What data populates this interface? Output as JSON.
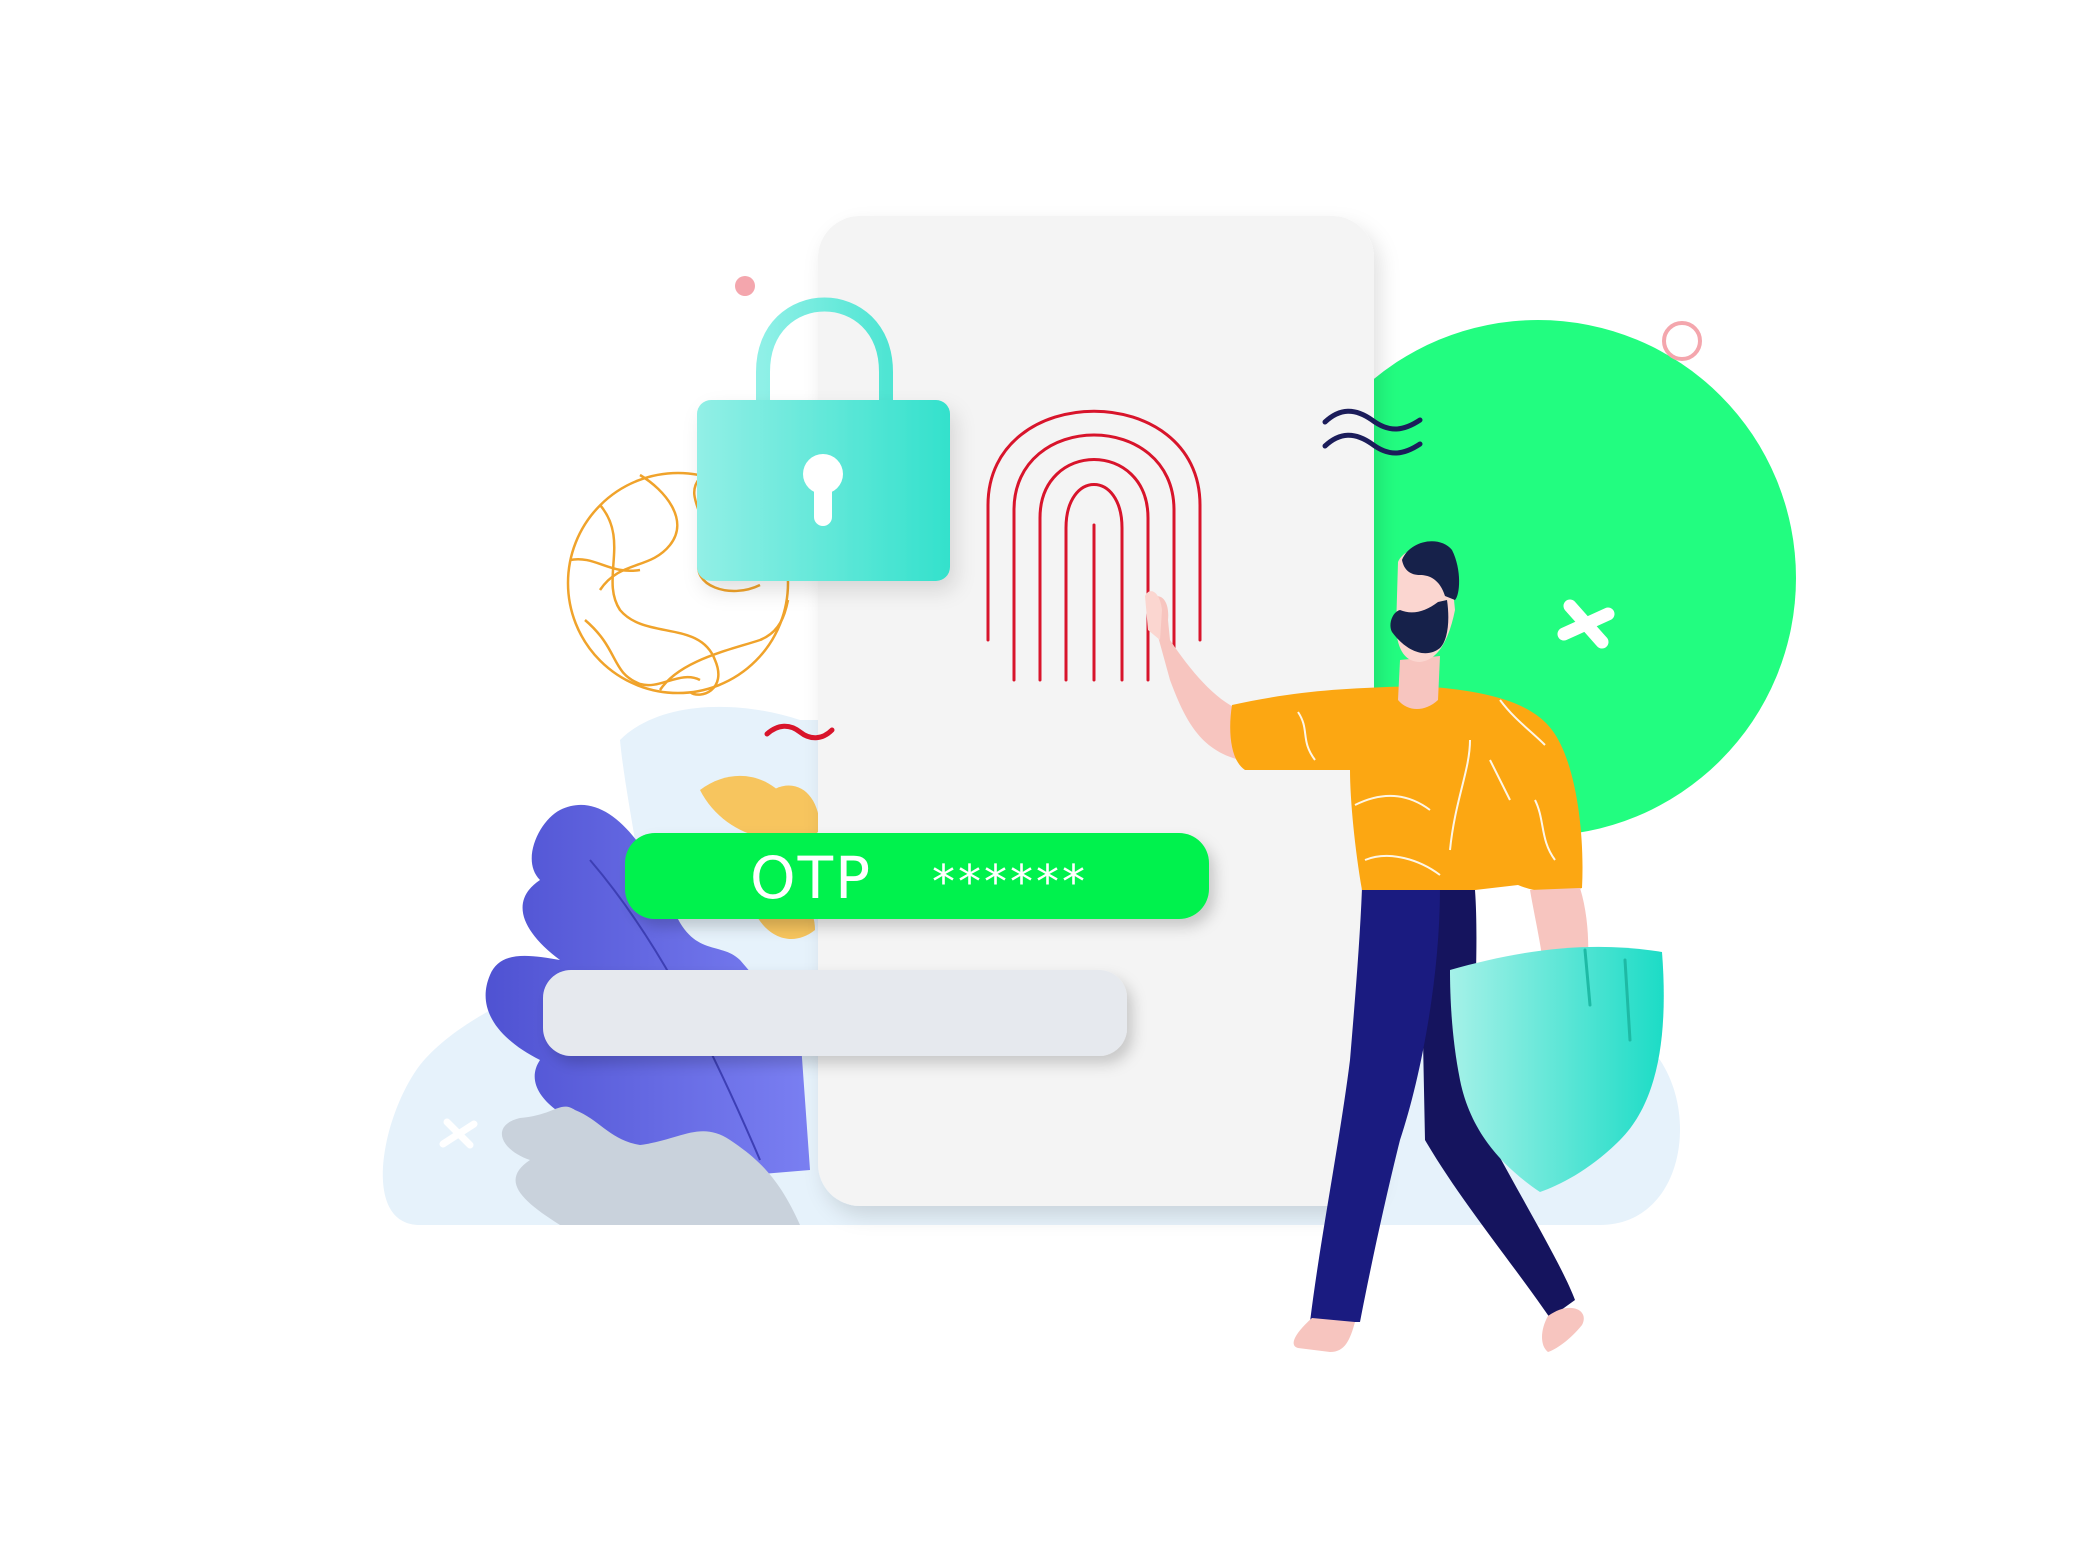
{
  "otp": {
    "label": "OTP",
    "masked_code": "******"
  },
  "icons": [
    "padlock-icon",
    "fingerprint-icon",
    "shield-icon",
    "globe-icon"
  ],
  "colors": {
    "background": "#ffffff",
    "phone_body": "#f4f4f4",
    "accent_green": "#22fd80",
    "otp_pill": "#00f24e",
    "teal": "#3fe4cf",
    "fingerprint_red": "#d8142b",
    "globe_orange": "#f0a32b",
    "shirt_orange": "#fca712",
    "pants_navy": "#1a1b80",
    "leaf_purple": "#6469ea",
    "cloud_blue": "#e6f2fb",
    "input_grey": "#e6e9ee"
  }
}
